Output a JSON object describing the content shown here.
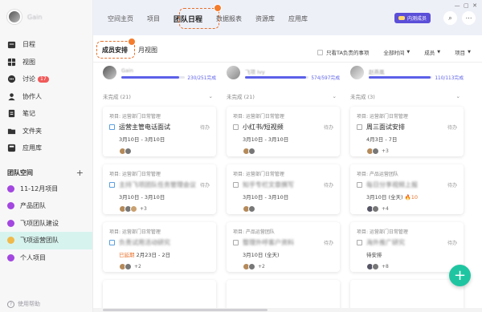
{
  "user": {
    "name": "Gain"
  },
  "nav": [
    {
      "label": "日程",
      "icon": "calendar-icon"
    },
    {
      "label": "视图",
      "icon": "grid-icon"
    },
    {
      "label": "讨论",
      "icon": "chat-icon",
      "badge": "17"
    },
    {
      "label": "协作人",
      "icon": "people-icon"
    },
    {
      "label": "笔记",
      "icon": "note-icon"
    },
    {
      "label": "文件夹",
      "icon": "folder-icon"
    },
    {
      "label": "应用库",
      "icon": "apps-icon"
    }
  ],
  "spaces": {
    "title": "团队空间",
    "add": "+",
    "items": [
      {
        "label": "11-12月项目",
        "color": "#a347e0"
      },
      {
        "label": "产品团队",
        "color": "#a347e0"
      },
      {
        "label": "飞项团队建设",
        "color": "#a347e0"
      },
      {
        "label": "飞项运营团队",
        "color": "#f0b94a",
        "active": true
      },
      {
        "label": "个人项目",
        "color": "#a347e0"
      }
    ]
  },
  "help": "使用帮助",
  "top_tabs": [
    "空间主页",
    "项目",
    "团队日程",
    "数据报表",
    "资源库",
    "应用库"
  ],
  "beta_label": "内测成员",
  "sub_tabs": [
    "成员安排",
    "月视图"
  ],
  "filters": {
    "only_mine": "只看TA负责的事项",
    "time": "全部时间",
    "member": "成员",
    "project": "项目"
  },
  "columns": [
    {
      "name": "Gain",
      "progress": "230/251完成",
      "ratio": 0.916,
      "group": "未完成 (21)",
      "cards": [
        {
          "project": "项目: 运营部门日常管理",
          "title": "运营主管电话面试",
          "status": "待办",
          "date": "3月10日 - 3月10日",
          "more": ""
        },
        {
          "project": "项目: 运营部门日常管理",
          "title": "主持飞项团队任务管理会议",
          "status": "待办",
          "date": "3月10日 - 3月10日",
          "more": "+3",
          "blur": true
        },
        {
          "project": "项目: 运营部门日常管理",
          "title": "负责试用活动研究",
          "status": "",
          "date": "2月23日 - 2日",
          "late": "已延期",
          "more": "+2",
          "blur": true
        }
      ]
    },
    {
      "name": "飞项 Ivy",
      "progress": "574/597完成",
      "ratio": 0.961,
      "group": "未完成 (21)",
      "cards": [
        {
          "project": "项目: 运营部门日常管理",
          "title": "小红书/短视频",
          "status": "待办",
          "date": "3月10日 - 3月10日",
          "more": ""
        },
        {
          "project": "项目: 运营部门日常管理",
          "title": "知乎专栏文章撰写",
          "status": "待办",
          "date": "3月10日 - 3月10日",
          "more": "",
          "blur": true
        },
        {
          "project": "项目: 产品运营团队",
          "title": "整理外呼客户资料",
          "status": "待办",
          "date": "3月10日 (全天)",
          "more": "+2",
          "blur": true
        }
      ]
    },
    {
      "name": "赵燕凰",
      "progress": "110/113完成",
      "ratio": 0.973,
      "group": "未完成 (3)",
      "cards": [
        {
          "project": "项目: 运营部门日常管理",
          "title": "周三面试安排",
          "status": "待办",
          "date": "4月3日 - 7日",
          "more": "+3"
        },
        {
          "project": "项目: 产品运营团队",
          "title": "每日分享视频上报",
          "status": "待办",
          "date": "3月10日 (全天)",
          "more": "+4",
          "fire": "10",
          "blur": true
        },
        {
          "project": "项目: 运营部门日常管理",
          "title": "海外推广研究",
          "status": "待办",
          "date": "待安排",
          "more": "+8",
          "blur": true
        }
      ]
    }
  ]
}
